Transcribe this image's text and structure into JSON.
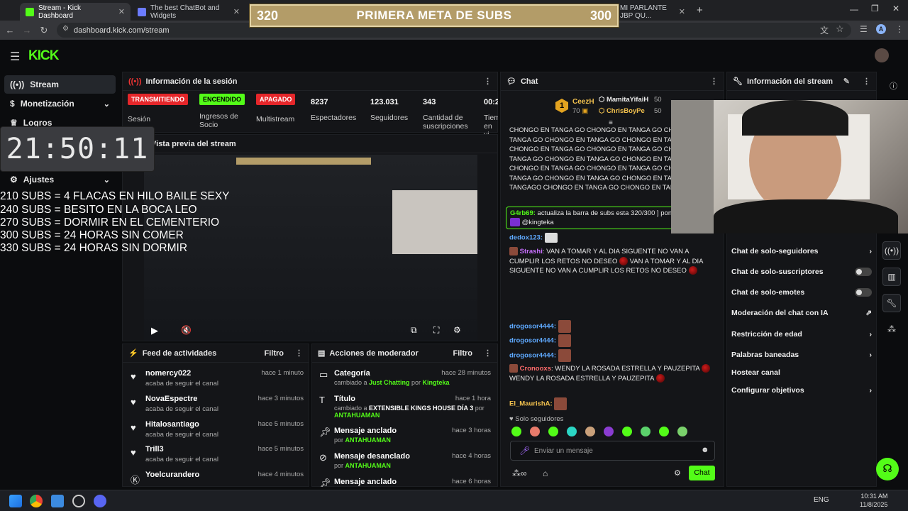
{
  "browser": {
    "tabs": [
      {
        "title": "Stream - Kick Dashboard",
        "active": true
      },
      {
        "title": "The best ChatBot and Widgets",
        "active": false
      },
      {
        "title": "MI PARLANTE JBP QU...",
        "active": false
      }
    ],
    "url": "dashboard.kick.com/stream"
  },
  "goal": {
    "left": "320",
    "title": "PRIMERA META DE SUBS",
    "right": "300"
  },
  "logo": "KICK",
  "sidebar": {
    "items": [
      {
        "label": "Stream",
        "icon": "broadcast-icon",
        "active": true
      },
      {
        "label": "Monetización",
        "icon": "dollar-icon"
      },
      {
        "label": "Logros",
        "icon": "trophy-icon"
      },
      {
        "label": "Ajustes",
        "icon": "gear-icon"
      }
    ]
  },
  "overlay": {
    "clock": "21:50:11",
    "lines": [
      "210 SUBS =  4 FLACAS EN HILO BAILE SEXY",
      "240 SUBS = BESITO EN LA BOCA LEO",
      "270 SUBS = DORMIR EN EL CEMENTERIO",
      "300 SUBS = 24 HORAS SIN COMER",
      "330 SUBS = 24 HORAS SIN DORMIR"
    ]
  },
  "session": {
    "title": "Información de la sesión",
    "metrics": [
      {
        "badge": "TRANSMITIENDO",
        "label": "Sesión",
        "color": "#e5262a"
      },
      {
        "badge": "ENCENDIDO",
        "label": "Ingresos de Socio",
        "color": "#53fc18"
      },
      {
        "badge": "APAGADO",
        "label": "Multistream",
        "color": "#e5262a"
      },
      {
        "value": "8237",
        "label": "Espectadores"
      },
      {
        "value": "123.031",
        "label": "Seguidores"
      },
      {
        "value": "343",
        "label": "Cantidad de suscripciones"
      },
      {
        "value": "00:2",
        "label": "Tiem en vi"
      }
    ]
  },
  "preview": {
    "title": "Vista previa del stream"
  },
  "feed": {
    "title": "Feed de actividades",
    "filter": "Filtro",
    "items": [
      {
        "name": "nomercy022",
        "sub": "acaba de seguir el canal",
        "time": "hace 1 minuto"
      },
      {
        "name": "NovaEspectre",
        "sub": "acaba de seguir el canal",
        "time": "hace 3 minutos"
      },
      {
        "name": "Hitalosantiago",
        "sub": "acaba de seguir el canal",
        "time": "hace 5 minutos"
      },
      {
        "name": "Trill3",
        "sub": "acaba de seguir el canal",
        "time": "hace 5 minutos"
      },
      {
        "name": "Yoelcurandero",
        "sub": "",
        "time": "hace 4 minutos"
      }
    ]
  },
  "mod": {
    "title": "Acciones de moderador",
    "filter": "Filtro",
    "items": [
      {
        "name": "Categoría",
        "pre": "cambiado a ",
        "hl": "Just Chatting",
        "mid": " por ",
        "user": "Kingteka",
        "time": "hace 28 minutos"
      },
      {
        "name": "Título",
        "pre": "cambiado a ",
        "hl": "EXTENSIBLE KINGS HOUSE DÍA 3",
        "mid": " por",
        "user": "ANTAHUAMAN",
        "time": "hace 1 hora"
      },
      {
        "name": "Mensaje anclado",
        "pre": "por ",
        "hl": "",
        "mid": "",
        "user": "ANTAHUAMAN",
        "time": "hace 3 horas"
      },
      {
        "name": "Mensaje desanclado",
        "pre": "por ",
        "hl": "",
        "mid": "",
        "user": "ANTAHUAMAN",
        "time": "hace 4 horas"
      },
      {
        "name": "Mensaje anclado",
        "pre": "",
        "hl": "",
        "mid": "",
        "user": "",
        "time": "hace 6 horas"
      }
    ]
  },
  "chat": {
    "title": "Chat",
    "top": [
      {
        "rank": "1",
        "name": "CeezH",
        "amount": "70"
      },
      {
        "name": "MamitaYifaiH",
        "amount": "50"
      },
      {
        "name": "ChrisBoyPe",
        "amount": "50"
      }
    ],
    "spam": [
      "CHONGO EN TANGA GO CHONGO EN TANGA GO CHONGO EN",
      "TANGA GO CHONGO EN TANGA GO CHONGO EN TANGA GO",
      "CHONGO EN TANGA GO CHONGO EN TANGA GO CHONGO EN",
      "TANGA GO CHONGO EN TANGA GO CHONGO EN TANGA GO",
      "CHONGO EN TANGA GO CHONGO EN TANGA GO CHONGO EN",
      "TANGA GO CHONGO EN TANGA GO CHONGO EN TANGA GO",
      "TANGAGO CHONGO EN TANGA GO CHONGO EN TANGA"
    ],
    "pinned_user": "G4rb69:",
    "pinned_text": "actualiza la barra de subs esta 320/300 ] pon",
    "pinned_mention": "@kingteka",
    "dedox": "dedox123:",
    "strashi_user": "Strashi",
    "strashi_msg": "VAN A TOMAR Y AL DIA SIGUENTE NO VAN A CUMPLIR LOS RETOS NO DESEO",
    "drogosor": "drogosor4444:",
    "cronooxs_user": "Cronooxs",
    "cronooxs_msg": "WENDY LA ROSADA ESTRELLA Y PAUZEPITA",
    "maurisha": "El_MaurishA:",
    "followers_only": "Solo seguidores",
    "input_placeholder": "Enviar un mensaje",
    "send": "Chat"
  },
  "info": {
    "title": "Información del stream",
    "settings": [
      {
        "label": "Chat de solo-seguidores",
        "control": "chevron"
      },
      {
        "label": "Chat de solo-suscriptores",
        "control": "toggle"
      },
      {
        "label": "Chat de solo-emotes",
        "control": "toggle"
      },
      {
        "label": "Moderación del chat con IA",
        "control": "external"
      },
      {
        "label": "Restricción de edad",
        "control": "chevron"
      },
      {
        "label": "Palabras baneadas",
        "control": "chevron"
      },
      {
        "label": "Hostear canal",
        "control": "none"
      },
      {
        "label": "Configurar objetivos",
        "control": "chevron"
      }
    ]
  },
  "taskbar": {
    "lang": "ENG",
    "time": "10:31 AM",
    "date": "11/8/2025"
  }
}
